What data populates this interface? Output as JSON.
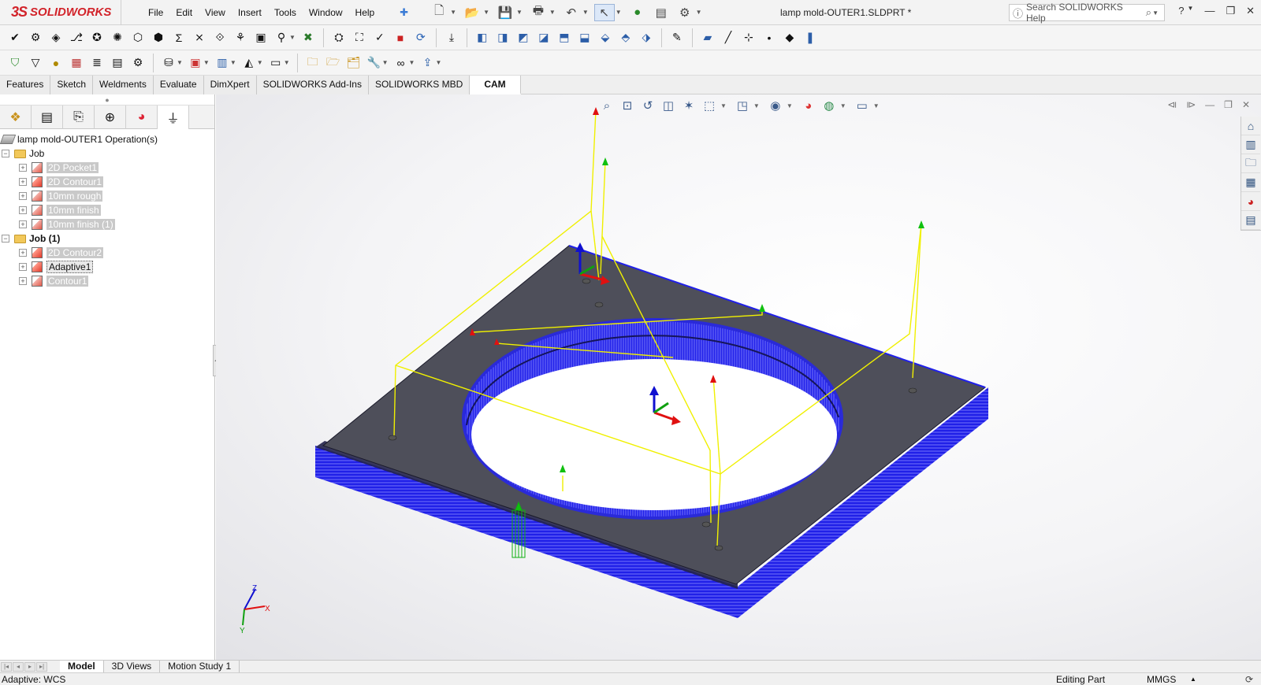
{
  "app": {
    "brand_ds": "3S",
    "brand_name": "SOLIDWORKS",
    "document_title": "lamp mold-OUTER1.SLDPRT *",
    "help_search_placeholder": "Search SOLIDWORKS Help"
  },
  "menu": [
    "File",
    "Edit",
    "View",
    "Insert",
    "Tools",
    "Window",
    "Help"
  ],
  "command_tabs": [
    {
      "label": "Features",
      "active": false
    },
    {
      "label": "Sketch",
      "active": false
    },
    {
      "label": "Weldments",
      "active": false
    },
    {
      "label": "Evaluate",
      "active": false
    },
    {
      "label": "DimXpert",
      "active": false
    },
    {
      "label": "SOLIDWORKS Add-Ins",
      "active": false
    },
    {
      "label": "SOLIDWORKS MBD",
      "active": false
    },
    {
      "label": "CAM",
      "active": true
    }
  ],
  "feature_tree": {
    "root": "lamp mold-OUTER1 Operation(s)",
    "jobs": [
      {
        "label": "Job",
        "operations": [
          {
            "label": "2D Pocket1",
            "state": "highlighted"
          },
          {
            "label": "2D Contour1",
            "state": "highlighted"
          },
          {
            "label": "10mm rough",
            "state": "highlighted"
          },
          {
            "label": "10mm finish",
            "state": "highlighted"
          },
          {
            "label": "10mm finish (1)",
            "state": "highlighted"
          }
        ]
      },
      {
        "label": "Job (1)",
        "operations": [
          {
            "label": "2D Contour2",
            "state": "highlighted"
          },
          {
            "label": "Adaptive1",
            "state": "selected"
          },
          {
            "label": "Contour1",
            "state": "highlighted"
          }
        ]
      }
    ]
  },
  "bottom_tabs": [
    {
      "label": "Model",
      "active": true
    },
    {
      "label": "3D Views",
      "active": false
    },
    {
      "label": "Motion Study 1",
      "active": false
    }
  ],
  "status": {
    "left": "Adaptive: WCS",
    "mode": "Editing Part",
    "units": "MMGS"
  },
  "triad_labels": {
    "x": "X",
    "y": "Y",
    "z": "Z"
  },
  "colors": {
    "brand": "#d2232a",
    "part_top": "#4e4f5a",
    "toolpath_blue": "#1a1aff",
    "rapid_yellow": "#f0f000",
    "selection_gray": "#c9c9c9"
  }
}
